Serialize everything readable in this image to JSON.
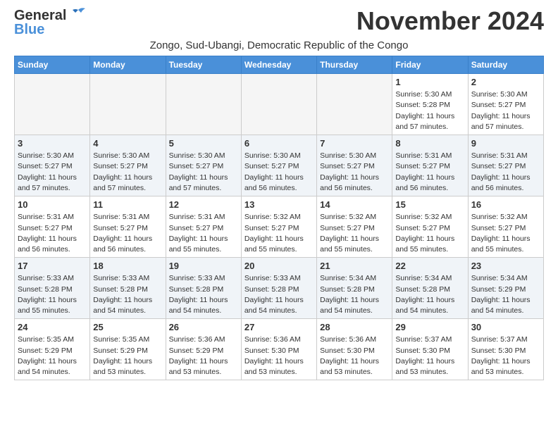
{
  "header": {
    "logo_general": "General",
    "logo_blue": "Blue",
    "month_title": "November 2024",
    "subtitle": "Zongo, Sud-Ubangi, Democratic Republic of the Congo"
  },
  "weekdays": [
    "Sunday",
    "Monday",
    "Tuesday",
    "Wednesday",
    "Thursday",
    "Friday",
    "Saturday"
  ],
  "weeks": [
    [
      {
        "day": "",
        "info": ""
      },
      {
        "day": "",
        "info": ""
      },
      {
        "day": "",
        "info": ""
      },
      {
        "day": "",
        "info": ""
      },
      {
        "day": "",
        "info": ""
      },
      {
        "day": "1",
        "info": "Sunrise: 5:30 AM\nSunset: 5:28 PM\nDaylight: 11 hours and 57 minutes."
      },
      {
        "day": "2",
        "info": "Sunrise: 5:30 AM\nSunset: 5:27 PM\nDaylight: 11 hours and 57 minutes."
      }
    ],
    [
      {
        "day": "3",
        "info": "Sunrise: 5:30 AM\nSunset: 5:27 PM\nDaylight: 11 hours and 57 minutes."
      },
      {
        "day": "4",
        "info": "Sunrise: 5:30 AM\nSunset: 5:27 PM\nDaylight: 11 hours and 57 minutes."
      },
      {
        "day": "5",
        "info": "Sunrise: 5:30 AM\nSunset: 5:27 PM\nDaylight: 11 hours and 57 minutes."
      },
      {
        "day": "6",
        "info": "Sunrise: 5:30 AM\nSunset: 5:27 PM\nDaylight: 11 hours and 56 minutes."
      },
      {
        "day": "7",
        "info": "Sunrise: 5:30 AM\nSunset: 5:27 PM\nDaylight: 11 hours and 56 minutes."
      },
      {
        "day": "8",
        "info": "Sunrise: 5:31 AM\nSunset: 5:27 PM\nDaylight: 11 hours and 56 minutes."
      },
      {
        "day": "9",
        "info": "Sunrise: 5:31 AM\nSunset: 5:27 PM\nDaylight: 11 hours and 56 minutes."
      }
    ],
    [
      {
        "day": "10",
        "info": "Sunrise: 5:31 AM\nSunset: 5:27 PM\nDaylight: 11 hours and 56 minutes."
      },
      {
        "day": "11",
        "info": "Sunrise: 5:31 AM\nSunset: 5:27 PM\nDaylight: 11 hours and 56 minutes."
      },
      {
        "day": "12",
        "info": "Sunrise: 5:31 AM\nSunset: 5:27 PM\nDaylight: 11 hours and 55 minutes."
      },
      {
        "day": "13",
        "info": "Sunrise: 5:32 AM\nSunset: 5:27 PM\nDaylight: 11 hours and 55 minutes."
      },
      {
        "day": "14",
        "info": "Sunrise: 5:32 AM\nSunset: 5:27 PM\nDaylight: 11 hours and 55 minutes."
      },
      {
        "day": "15",
        "info": "Sunrise: 5:32 AM\nSunset: 5:27 PM\nDaylight: 11 hours and 55 minutes."
      },
      {
        "day": "16",
        "info": "Sunrise: 5:32 AM\nSunset: 5:27 PM\nDaylight: 11 hours and 55 minutes."
      }
    ],
    [
      {
        "day": "17",
        "info": "Sunrise: 5:33 AM\nSunset: 5:28 PM\nDaylight: 11 hours and 55 minutes."
      },
      {
        "day": "18",
        "info": "Sunrise: 5:33 AM\nSunset: 5:28 PM\nDaylight: 11 hours and 54 minutes."
      },
      {
        "day": "19",
        "info": "Sunrise: 5:33 AM\nSunset: 5:28 PM\nDaylight: 11 hours and 54 minutes."
      },
      {
        "day": "20",
        "info": "Sunrise: 5:33 AM\nSunset: 5:28 PM\nDaylight: 11 hours and 54 minutes."
      },
      {
        "day": "21",
        "info": "Sunrise: 5:34 AM\nSunset: 5:28 PM\nDaylight: 11 hours and 54 minutes."
      },
      {
        "day": "22",
        "info": "Sunrise: 5:34 AM\nSunset: 5:28 PM\nDaylight: 11 hours and 54 minutes."
      },
      {
        "day": "23",
        "info": "Sunrise: 5:34 AM\nSunset: 5:29 PM\nDaylight: 11 hours and 54 minutes."
      }
    ],
    [
      {
        "day": "24",
        "info": "Sunrise: 5:35 AM\nSunset: 5:29 PM\nDaylight: 11 hours and 54 minutes."
      },
      {
        "day": "25",
        "info": "Sunrise: 5:35 AM\nSunset: 5:29 PM\nDaylight: 11 hours and 53 minutes."
      },
      {
        "day": "26",
        "info": "Sunrise: 5:36 AM\nSunset: 5:29 PM\nDaylight: 11 hours and 53 minutes."
      },
      {
        "day": "27",
        "info": "Sunrise: 5:36 AM\nSunset: 5:30 PM\nDaylight: 11 hours and 53 minutes."
      },
      {
        "day": "28",
        "info": "Sunrise: 5:36 AM\nSunset: 5:30 PM\nDaylight: 11 hours and 53 minutes."
      },
      {
        "day": "29",
        "info": "Sunrise: 5:37 AM\nSunset: 5:30 PM\nDaylight: 11 hours and 53 minutes."
      },
      {
        "day": "30",
        "info": "Sunrise: 5:37 AM\nSunset: 5:30 PM\nDaylight: 11 hours and 53 minutes."
      }
    ]
  ]
}
